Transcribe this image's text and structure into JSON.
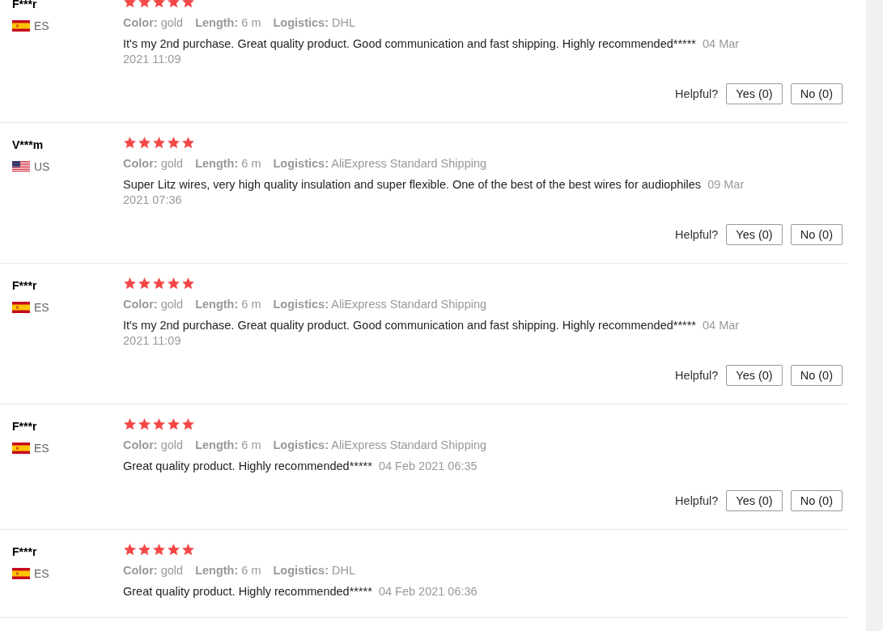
{
  "reviews": [
    {
      "user": "F***r",
      "kind": "spain",
      "country": "ES",
      "stars": 5,
      "attributes": [
        {
          "label": "Color:",
          "value": "gold"
        },
        {
          "label": "Length:",
          "value": "6 m"
        },
        {
          "label": "Logistics:",
          "value": "DHL"
        }
      ],
      "text": "It's my 2nd purchase. Great quality product. Good communication and fast shipping. Highly recommended*****",
      "date": "04 Mar 2021 11:09",
      "helpful": {
        "label": "Helpful?",
        "yes": "Yes (0)",
        "no": "No (0)"
      }
    },
    {
      "user": "V***m",
      "kind": "usa",
      "country": "US",
      "stars": 5,
      "attributes": [
        {
          "label": "Color:",
          "value": "gold"
        },
        {
          "label": "Length:",
          "value": "6 m"
        },
        {
          "label": "Logistics:",
          "value": "AliExpress Standard Shipping"
        }
      ],
      "text": "Super Litz wires, very high quality insulation and super flexible. One of the best of the best wires for audiophiles",
      "date": "09 Mar 2021 07:36",
      "helpful": {
        "label": "Helpful?",
        "yes": "Yes (0)",
        "no": "No (0)"
      }
    },
    {
      "user": "F***r",
      "kind": "spain",
      "country": "ES",
      "stars": 5,
      "attributes": [
        {
          "label": "Color:",
          "value": "gold"
        },
        {
          "label": "Length:",
          "value": "6 m"
        },
        {
          "label": "Logistics:",
          "value": "AliExpress Standard Shipping"
        }
      ],
      "text": "It's my 2nd purchase. Great quality product. Good communication and fast shipping. Highly recommended*****",
      "date": "04 Mar 2021 11:09",
      "helpful": {
        "label": "Helpful?",
        "yes": "Yes (0)",
        "no": "No (0)"
      }
    },
    {
      "user": "F***r",
      "kind": "spain",
      "country": "ES",
      "stars": 5,
      "attributes": [
        {
          "label": "Color:",
          "value": "gold"
        },
        {
          "label": "Length:",
          "value": "6 m"
        },
        {
          "label": "Logistics:",
          "value": "AliExpress Standard Shipping"
        }
      ],
      "text": "Great quality product. Highly recommended*****",
      "date": "04 Feb 2021 06:35",
      "helpful": {
        "label": "Helpful?",
        "yes": "Yes (0)",
        "no": "No (0)"
      }
    },
    {
      "user": "F***r",
      "kind": "spain",
      "country": "ES",
      "stars": 5,
      "attributes": [
        {
          "label": "Color:",
          "value": "gold"
        },
        {
          "label": "Length:",
          "value": "6 m"
        },
        {
          "label": "Logistics:",
          "value": "DHL"
        }
      ],
      "text": "Great quality product. Highly recommended*****",
      "date": "04 Feb 2021 06:36"
    }
  ]
}
